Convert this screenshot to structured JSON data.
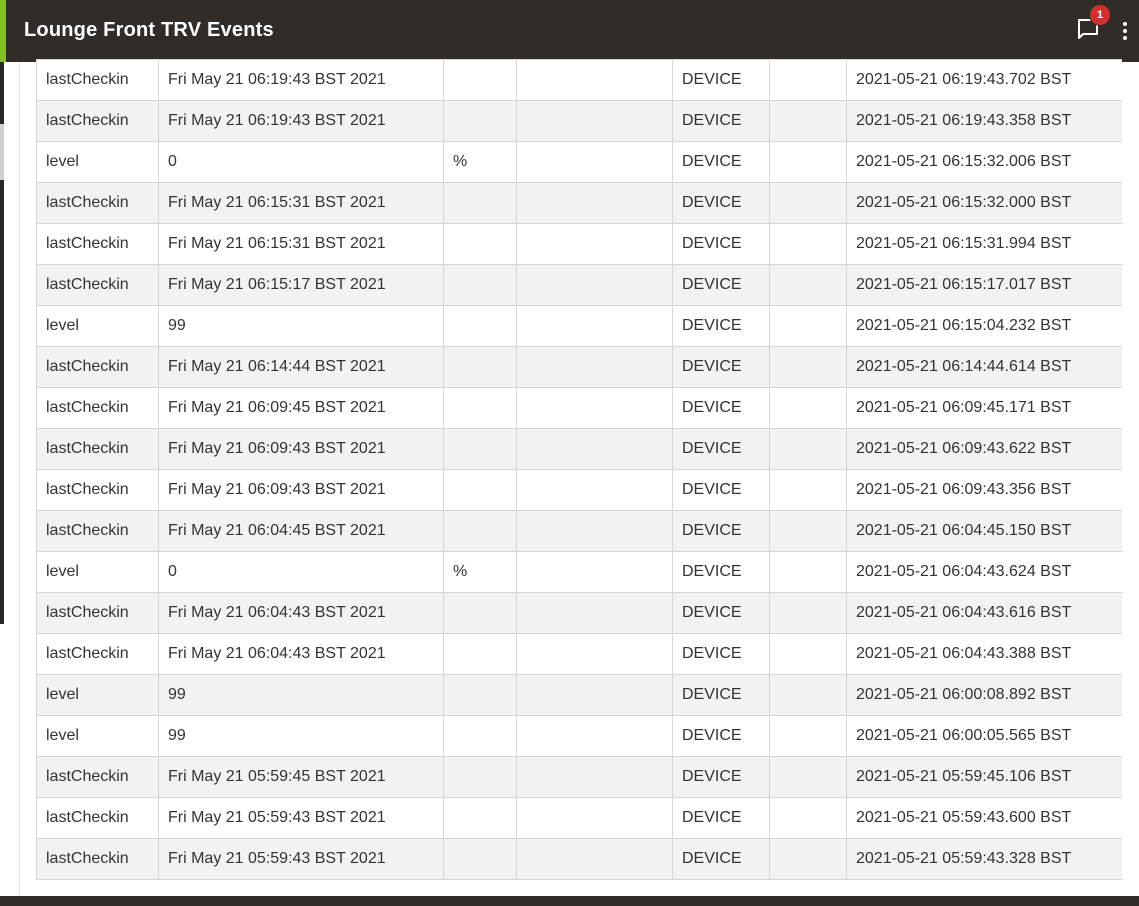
{
  "header": {
    "title": "Lounge Front TRV Events",
    "notification_count": "1",
    "chat_icon": "chat-bubble-icon",
    "more_icon": "more-vert-icon"
  },
  "colors": {
    "header_bg": "#312c28",
    "accent": "#84c225",
    "badge": "#d32f2f"
  },
  "events": {
    "rows": [
      {
        "name": "lastCheckin",
        "value": "Fri May 21 06:19:43 BST 2021",
        "unit": "",
        "description": "",
        "source": "DEVICE",
        "type": "",
        "date": "2021-05-21 06:19:43.702 BST"
      },
      {
        "name": "lastCheckin",
        "value": "Fri May 21 06:19:43 BST 2021",
        "unit": "",
        "description": "",
        "source": "DEVICE",
        "type": "",
        "date": "2021-05-21 06:19:43.358 BST"
      },
      {
        "name": "level",
        "value": "0",
        "unit": "%",
        "description": "",
        "source": "DEVICE",
        "type": "",
        "date": "2021-05-21 06:15:32.006 BST"
      },
      {
        "name": "lastCheckin",
        "value": "Fri May 21 06:15:31 BST 2021",
        "unit": "",
        "description": "",
        "source": "DEVICE",
        "type": "",
        "date": "2021-05-21 06:15:32.000 BST"
      },
      {
        "name": "lastCheckin",
        "value": "Fri May 21 06:15:31 BST 2021",
        "unit": "",
        "description": "",
        "source": "DEVICE",
        "type": "",
        "date": "2021-05-21 06:15:31.994 BST"
      },
      {
        "name": "lastCheckin",
        "value": "Fri May 21 06:15:17 BST 2021",
        "unit": "",
        "description": "",
        "source": "DEVICE",
        "type": "",
        "date": "2021-05-21 06:15:17.017 BST"
      },
      {
        "name": "level",
        "value": "99",
        "unit": "",
        "description": "",
        "source": "DEVICE",
        "type": "",
        "date": "2021-05-21 06:15:04.232 BST"
      },
      {
        "name": "lastCheckin",
        "value": "Fri May 21 06:14:44 BST 2021",
        "unit": "",
        "description": "",
        "source": "DEVICE",
        "type": "",
        "date": "2021-05-21 06:14:44.614 BST"
      },
      {
        "name": "lastCheckin",
        "value": "Fri May 21 06:09:45 BST 2021",
        "unit": "",
        "description": "",
        "source": "DEVICE",
        "type": "",
        "date": "2021-05-21 06:09:45.171 BST"
      },
      {
        "name": "lastCheckin",
        "value": "Fri May 21 06:09:43 BST 2021",
        "unit": "",
        "description": "",
        "source": "DEVICE",
        "type": "",
        "date": "2021-05-21 06:09:43.622 BST"
      },
      {
        "name": "lastCheckin",
        "value": "Fri May 21 06:09:43 BST 2021",
        "unit": "",
        "description": "",
        "source": "DEVICE",
        "type": "",
        "date": "2021-05-21 06:09:43.356 BST"
      },
      {
        "name": "lastCheckin",
        "value": "Fri May 21 06:04:45 BST 2021",
        "unit": "",
        "description": "",
        "source": "DEVICE",
        "type": "",
        "date": "2021-05-21 06:04:45.150 BST"
      },
      {
        "name": "level",
        "value": "0",
        "unit": "%",
        "description": "",
        "source": "DEVICE",
        "type": "",
        "date": "2021-05-21 06:04:43.624 BST"
      },
      {
        "name": "lastCheckin",
        "value": "Fri May 21 06:04:43 BST 2021",
        "unit": "",
        "description": "",
        "source": "DEVICE",
        "type": "",
        "date": "2021-05-21 06:04:43.616 BST"
      },
      {
        "name": "lastCheckin",
        "value": "Fri May 21 06:04:43 BST 2021",
        "unit": "",
        "description": "",
        "source": "DEVICE",
        "type": "",
        "date": "2021-05-21 06:04:43.388 BST"
      },
      {
        "name": "level",
        "value": "99",
        "unit": "",
        "description": "",
        "source": "DEVICE",
        "type": "",
        "date": "2021-05-21 06:00:08.892 BST"
      },
      {
        "name": "level",
        "value": "99",
        "unit": "",
        "description": "",
        "source": "DEVICE",
        "type": "",
        "date": "2021-05-21 06:00:05.565 BST"
      },
      {
        "name": "lastCheckin",
        "value": "Fri May 21 05:59:45 BST 2021",
        "unit": "",
        "description": "",
        "source": "DEVICE",
        "type": "",
        "date": "2021-05-21 05:59:45.106 BST"
      },
      {
        "name": "lastCheckin",
        "value": "Fri May 21 05:59:43 BST 2021",
        "unit": "",
        "description": "",
        "source": "DEVICE",
        "type": "",
        "date": "2021-05-21 05:59:43.600 BST"
      },
      {
        "name": "lastCheckin",
        "value": "Fri May 21 05:59:43 BST 2021",
        "unit": "",
        "description": "",
        "source": "DEVICE",
        "type": "",
        "date": "2021-05-21 05:59:43.328 BST"
      }
    ]
  }
}
